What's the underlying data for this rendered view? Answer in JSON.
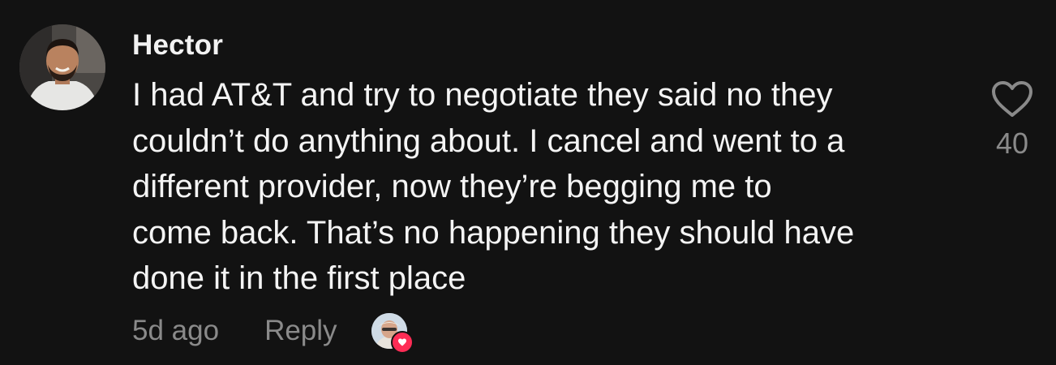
{
  "comment": {
    "author": "Hector",
    "lines": [
      "I had AT&T and try to negotiate they said no they",
      "couldn’t do anything about. I cancel and went to a",
      "different provider, now they’re begging me to",
      "come back. That’s no happening they should have",
      "done it in the first place"
    ],
    "time": "5d ago",
    "reply_label": "Reply",
    "like_count": "40"
  },
  "colors": {
    "background": "#121212",
    "text": "#f4f4f4",
    "muted": "#8a8a8a",
    "heart_badge": "#fe2c55"
  },
  "icons": {
    "like": "heart-outline-icon",
    "creator_liked": "heart-filled-icon"
  }
}
